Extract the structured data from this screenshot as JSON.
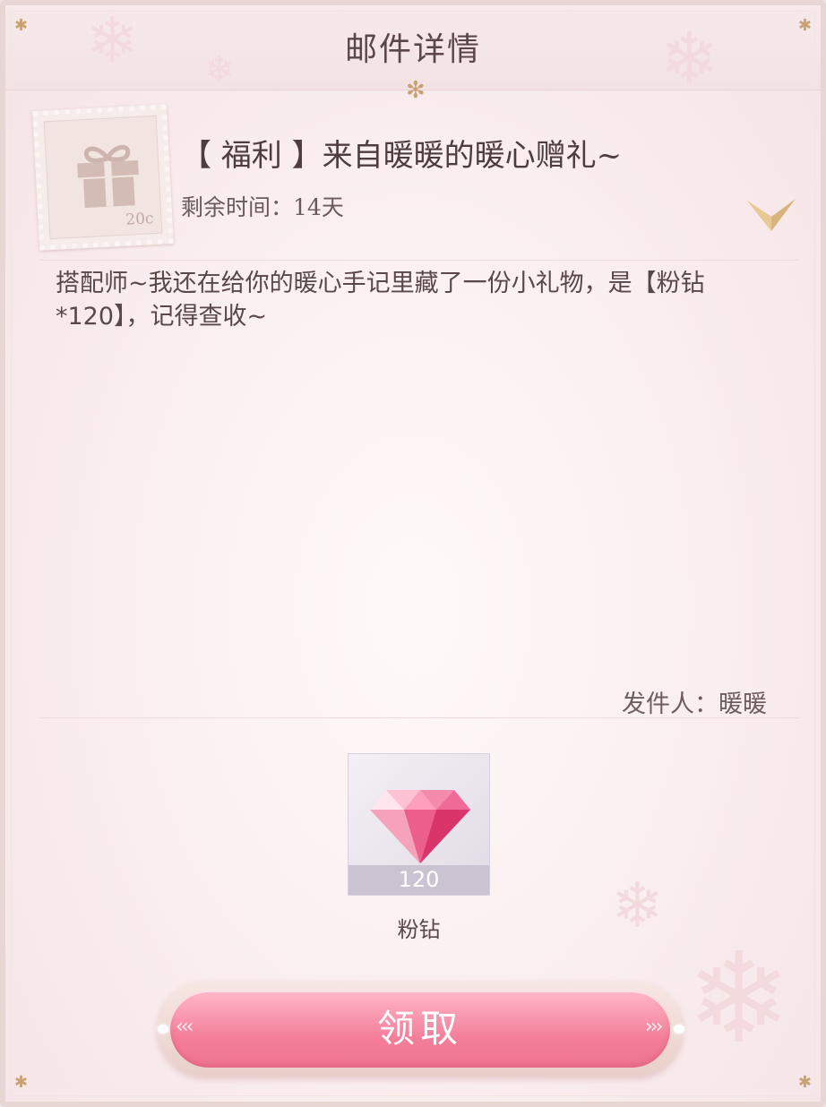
{
  "header": {
    "title": "邮件详情"
  },
  "mail": {
    "stamp_value": "20c",
    "subject": "【 福利 】来自暖暖的暖心赠礼~",
    "remaining_label": "剩余时间：",
    "remaining_value": "14天",
    "body": "搭配师~我还在给你的暖心手记里藏了一份小礼物，是【粉钻*120】，记得查收~",
    "sender_label": "发件人：",
    "sender_name": "暖暖"
  },
  "attachment": {
    "icon": "pink-diamond-icon",
    "count": "120",
    "name": "粉钻"
  },
  "actions": {
    "claim_label": "领取"
  },
  "colors": {
    "accent": "#f47f9b",
    "gold": "#c9a274",
    "text": "#5a4748"
  }
}
